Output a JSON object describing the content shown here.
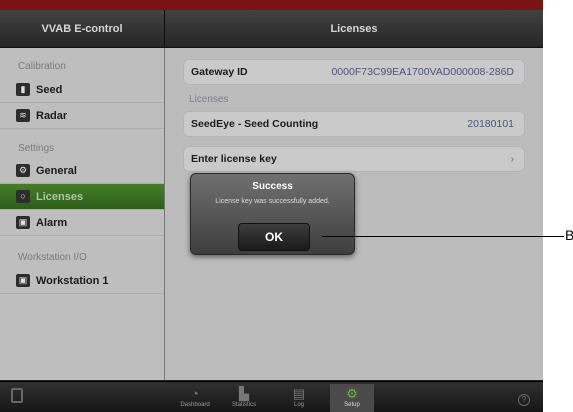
{
  "header": {
    "left_title": "VVAB E-control",
    "right_title": "Licenses"
  },
  "sidebar": {
    "sections": [
      {
        "title": "Calibration",
        "items": [
          {
            "label": "Seed"
          },
          {
            "label": "Radar"
          }
        ]
      },
      {
        "title": "Settings",
        "items": [
          {
            "label": "General"
          },
          {
            "label": "Licenses",
            "active": true
          },
          {
            "label": "Alarm"
          }
        ]
      },
      {
        "title": "Workstation I/O",
        "items": [
          {
            "label": "Workstation 1"
          }
        ]
      }
    ]
  },
  "content": {
    "gateway": {
      "label": "Gateway ID",
      "value": "0000F73C99EA1700VAD000008-286D"
    },
    "licenses_header": "Licenses",
    "license_row": {
      "label": "SeedEye - Seed Counting",
      "value": "20180101"
    },
    "enter_key": {
      "label": "Enter license key",
      "chevron": "›"
    }
  },
  "dialog": {
    "title": "Success",
    "message": "License key was successfully added.",
    "ok_label": "OK"
  },
  "footer": {
    "tabs": [
      {
        "label": "Dashboard",
        "icon": "gauge-icon"
      },
      {
        "label": "Statistics",
        "icon": "bar-chart-icon"
      },
      {
        "label": "Log",
        "icon": "document-icon"
      },
      {
        "label": "Setup",
        "icon": "gears-icon",
        "active": true
      }
    ],
    "help_glyph": "?"
  },
  "callout": {
    "label": "B"
  },
  "colors": {
    "accent": "#3e7a24",
    "brand_bar": "#7a1414",
    "header": "#3a3a3a"
  }
}
